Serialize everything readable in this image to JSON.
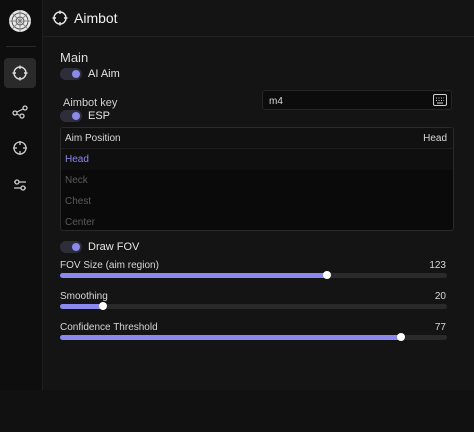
{
  "header": {
    "title": "Aimbot"
  },
  "sidebar": {
    "items": [
      {
        "icon": "crosshair-icon",
        "active": true
      },
      {
        "icon": "nodes-icon",
        "active": false
      },
      {
        "icon": "target-icon",
        "active": false
      },
      {
        "icon": "sliders-icon",
        "active": false
      }
    ]
  },
  "main": {
    "section_title": "Main",
    "ai_aim": {
      "label": "AI Aim",
      "on": true
    },
    "aimbot_key": {
      "label": "Aimbot key",
      "value": "m4"
    },
    "esp": {
      "label": "ESP",
      "on": true
    },
    "aim_position": {
      "label": "Aim Position",
      "selected": "Head",
      "options": [
        "Head",
        "Neck",
        "Chest",
        "Center"
      ]
    },
    "draw_fov": {
      "label": "Draw FOV",
      "on": true
    },
    "sliders": [
      {
        "label": "FOV Size (aim region)",
        "value": 123,
        "fraction": 0.69
      },
      {
        "label": "Smoothing",
        "value": 20,
        "fraction": 0.11
      },
      {
        "label": "Confidence Threshold",
        "value": 77,
        "fraction": 0.88
      }
    ]
  },
  "colors": {
    "accent": "#8b88ee",
    "background": "#141414",
    "sidebar": "#0e0e0e"
  }
}
